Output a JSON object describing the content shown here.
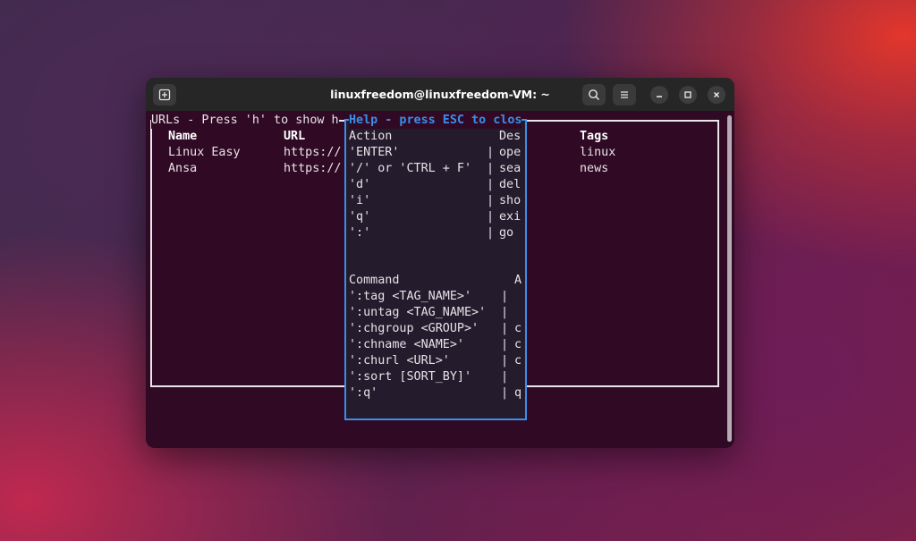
{
  "window": {
    "title": "linuxfreedom@linuxfreedom-VM: ~",
    "new_tab_icon": "new-tab-icon",
    "search_icon": "search-icon",
    "menu_icon": "hamburger-menu-icon",
    "minimize_icon": "minimize-icon",
    "maximize_icon": "maximize-icon",
    "close_icon": "close-icon"
  },
  "main": {
    "header": "URLs - Press 'h' to show h",
    "columns": {
      "name": "Name",
      "url": "URL",
      "tags": "Tags"
    },
    "rows": [
      {
        "name": "Linux Easy",
        "url": "https://",
        "tags": "linux"
      },
      {
        "name": "Ansa",
        "url": "https://",
        "tags": "news"
      }
    ]
  },
  "help": {
    "title": "Help - press ESC to clos",
    "actions_header": {
      "action": "Action",
      "desc": "Des"
    },
    "actions": [
      {
        "key": "'ENTER'",
        "sep": "|",
        "desc": "ope"
      },
      {
        "key": "'/' or 'CTRL + F'",
        "sep": "|",
        "desc": "sea"
      },
      {
        "key": "'d'",
        "sep": "|",
        "desc": "del"
      },
      {
        "key": "'i'",
        "sep": "|",
        "desc": "sho"
      },
      {
        "key": "'q'",
        "sep": "|",
        "desc": "exi"
      },
      {
        "key": "':'",
        "sep": "|",
        "desc": "go"
      }
    ],
    "commands_header": {
      "command": "Command",
      "desc": "A"
    },
    "commands": [
      {
        "cmd": "':tag <TAG_NAME>'",
        "sep": "|",
        "desc": ""
      },
      {
        "cmd": "':untag <TAG_NAME>'",
        "sep": "|",
        "desc": ""
      },
      {
        "cmd": "':chgroup <GROUP>'",
        "sep": "|",
        "desc": "c"
      },
      {
        "cmd": "':chname <NAME>'",
        "sep": "|",
        "desc": "c"
      },
      {
        "cmd": "':churl <URL>'",
        "sep": "|",
        "desc": "c"
      },
      {
        "cmd": "':sort [SORT_BY]'",
        "sep": "|",
        "desc": ""
      },
      {
        "cmd": "':q'",
        "sep": "|",
        "desc": "q"
      }
    ]
  },
  "colors": {
    "terminal_bg": "#300a24",
    "titlebar_bg": "#262626",
    "help_border": "#3b8ee8",
    "text": "#e8e2e6"
  }
}
